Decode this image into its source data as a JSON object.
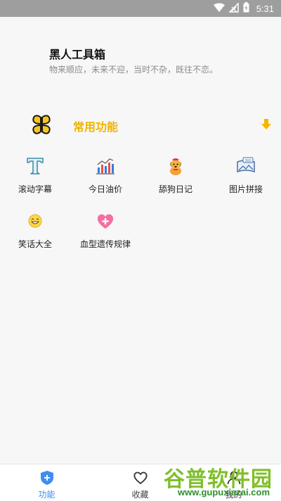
{
  "status_bar": {
    "time": "5:31",
    "icons": [
      "wifi-icon",
      "signal-icon",
      "battery-charging-icon"
    ]
  },
  "header": {
    "title": "黑人工具箱",
    "subtitle": "物来顺应，未来不迎，当时不杂，既往不恋。"
  },
  "section": {
    "title": "常用功能",
    "icon": "clover-icon",
    "arrow_icon": "download-arrow-icon",
    "accent_color": "#f0b400"
  },
  "tools": [
    {
      "label": "滚动字幕",
      "icon": "letter-t-icon"
    },
    {
      "label": "今日油价",
      "icon": "bar-chart-icon"
    },
    {
      "label": "舔狗日记",
      "icon": "dog-icon"
    },
    {
      "label": "图片拼接",
      "icon": "panorama-360-icon"
    },
    {
      "label": "笑话大全",
      "icon": "laughing-face-icon"
    },
    {
      "label": "血型遗传规律",
      "icon": "heart-plus-icon"
    }
  ],
  "bottom_nav": [
    {
      "label": "功能",
      "icon": "shield-plus-icon",
      "active": true,
      "color": "#3d8ef0"
    },
    {
      "label": "收藏",
      "icon": "heart-outline-icon",
      "active": false
    },
    {
      "label": "我的",
      "icon": "user-icon",
      "active": false
    }
  ],
  "watermark": {
    "text": "谷普软件园",
    "url": "www.gupuxiazai.com"
  }
}
